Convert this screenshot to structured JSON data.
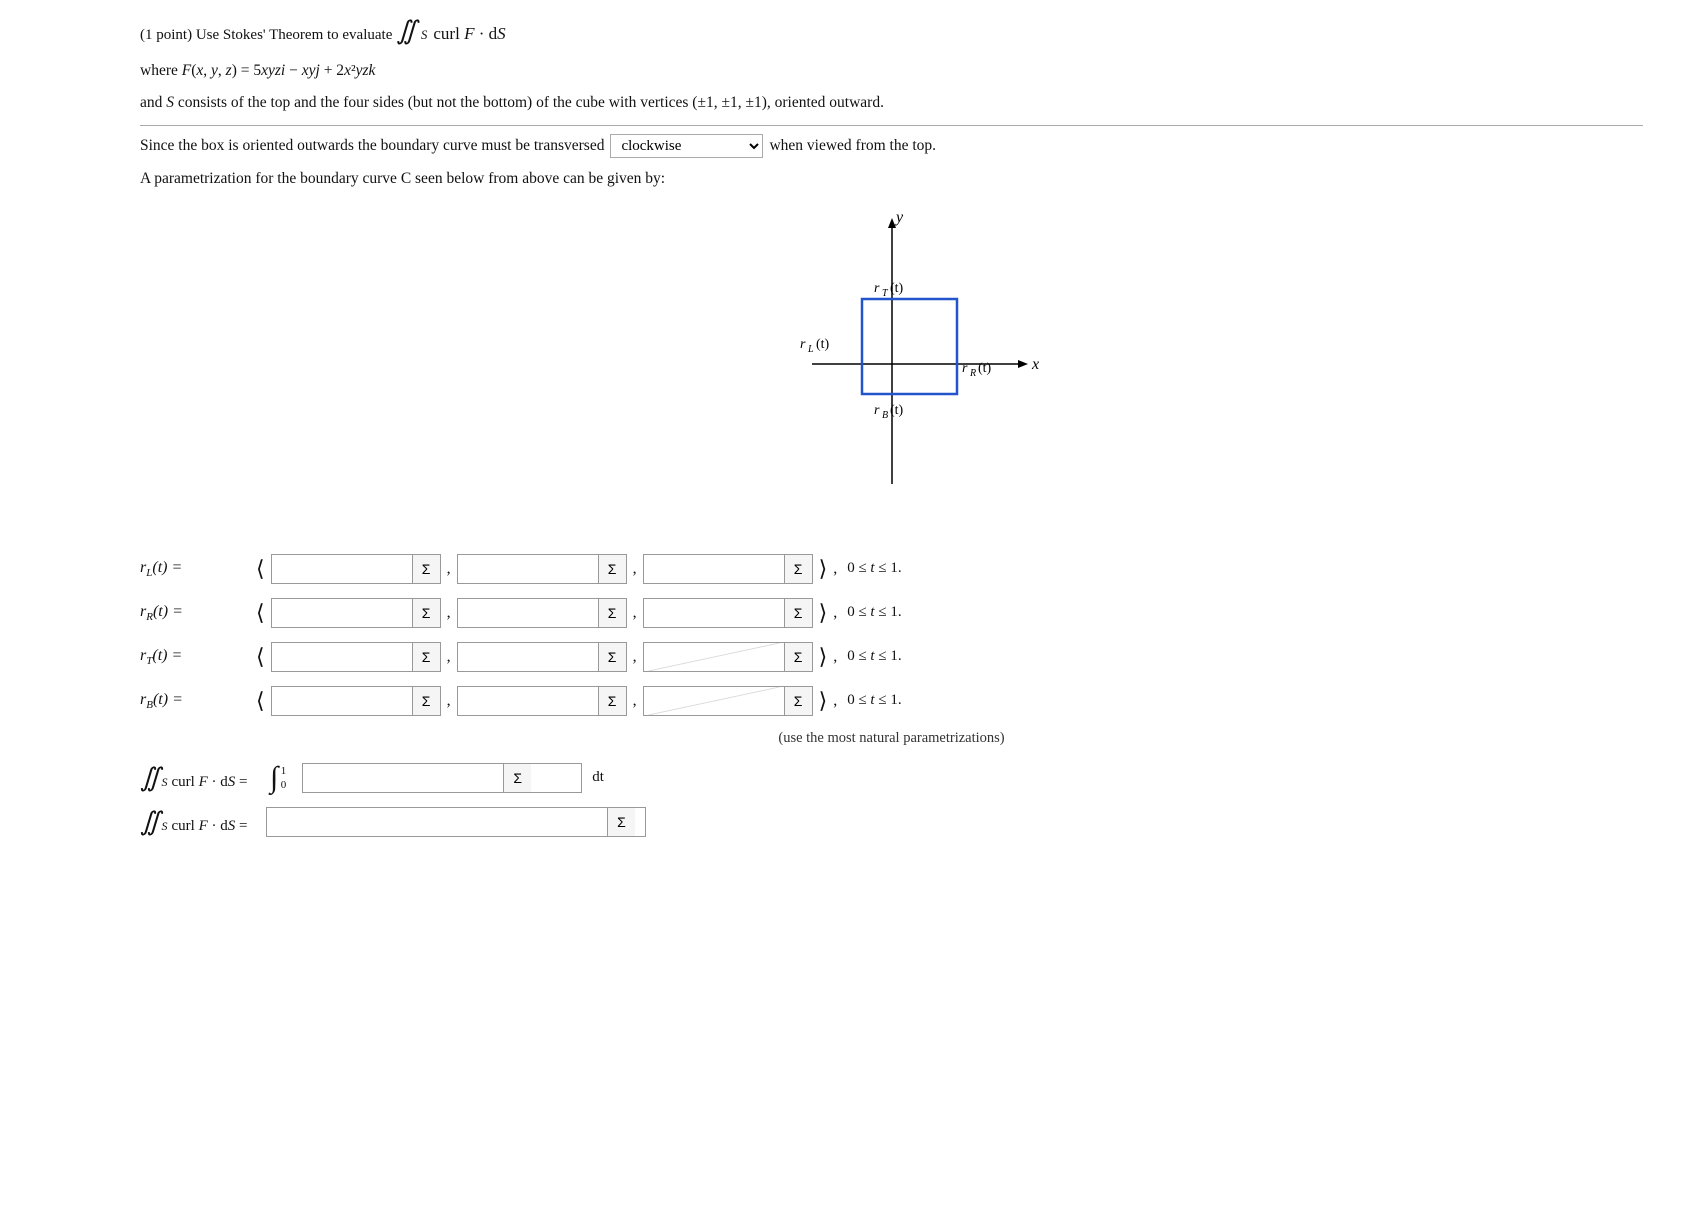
{
  "page": {
    "problem_intro": "(1 point) Use Stokes' Theorem to evaluate",
    "integral_notation": "∬",
    "integral_sub": "S",
    "integral_expression": "curl F · dS",
    "where_label": "where F(x, y, z) = 5xyzi − xyj + 2x²yzk",
    "and_s_text": "and S consists of the top and the four sides (but not the bottom) of the cube with vertices (±1, ±1, ±1), oriented outward.",
    "oriented_text": "Since the box is oriented outwards the boundary curve must be transversed",
    "dropdown_value": "clockwise",
    "dropdown_options": [
      "clockwise",
      "counterclockwise"
    ],
    "when_viewed": "when viewed from the top.",
    "param_intro": "A parametrization for the boundary curve C seen below from above can be given by:",
    "diagram": {
      "y_label": "y",
      "x_label": "x",
      "rT_label": "r_T(t)",
      "rL_label": "r_L(t)",
      "rR_label": "r_R(t)",
      "rB_label": "r_B(t)"
    },
    "rows": [
      {
        "label": "r_L(t) =",
        "label_display": "r_L(t) =",
        "constraint": "0 ≤ t ≤ 1."
      },
      {
        "label": "r_R(t) =",
        "label_display": "r_R(t) =",
        "constraint": "0 ≤ t ≤ 1."
      },
      {
        "label": "r_T(t) =",
        "label_display": "r_T(t) =",
        "constraint": "0 ≤ t ≤ 1."
      },
      {
        "label": "r_B(t) =",
        "label_display": "r_B(t) =",
        "constraint": "0 ≤ t ≤ 1."
      }
    ],
    "use_natural": "(use the most natural parametrizations)",
    "integral_equals": "∬",
    "integral_sub2": "S",
    "curl_dS_label": "curl F · dS =",
    "int_lower": "0",
    "int_upper": "1",
    "dt_label": "dt",
    "sigma_label": "Σ",
    "final_integral_label": "∬",
    "final_integral_sub": "S",
    "final_curl_label": "curl F · dS ="
  }
}
